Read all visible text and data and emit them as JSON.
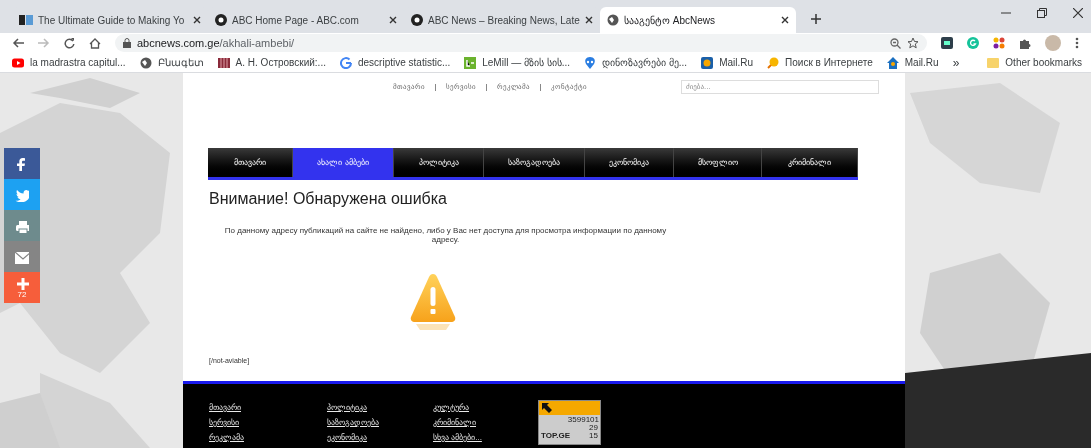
{
  "browser": {
    "tabs": [
      {
        "title": "The Ultimate Guide to Making Yo",
        "kind": "sb",
        "selected": false
      },
      {
        "title": "ABC Home Page - ABC.com",
        "kind": "abc",
        "selected": false
      },
      {
        "title": "ABC News – Breaking News, Late",
        "kind": "abc",
        "selected": false
      },
      {
        "title": "სააგენტო AbcNews",
        "kind": "globe",
        "selected": true
      }
    ],
    "url": {
      "host": "abcnews.com.ge",
      "path": "/akhali-ambebi/"
    },
    "bookmarks": [
      {
        "label": "la madrastra capitul...",
        "kind": "youtube"
      },
      {
        "label": "Բնագետ",
        "kind": "globe"
      },
      {
        "label": "А. Н. Островский:...",
        "kind": "books"
      },
      {
        "label": "descriptive statistic...",
        "kind": "google"
      },
      {
        "label": "LeMill — მზის სის...",
        "kind": "lemill"
      },
      {
        "label": "დინოზავრები მე...",
        "kind": "alien"
      },
      {
        "label": "Mail.Ru",
        "kind": "mail"
      },
      {
        "label": "Поиск в Интернете",
        "kind": "search"
      },
      {
        "label": "Mail.Ru",
        "kind": "house"
      }
    ],
    "overflow": "»",
    "other_bookmarks": "Other bookmarks"
  },
  "page": {
    "top_links": [
      "მთავარი",
      "სერვისი",
      "რეკლამა",
      "კონტაქტი"
    ],
    "search": {
      "placeholder": "ძიება..."
    },
    "nav": [
      {
        "label": "მთავარი",
        "selected": false
      },
      {
        "label": "ახალი ამბები",
        "selected": true
      },
      {
        "label": "პოლიტიკა",
        "selected": false
      },
      {
        "label": "საზოგადოება",
        "selected": false
      },
      {
        "label": "ეკონომიკა",
        "selected": false
      },
      {
        "label": "მსოფლიო",
        "selected": false
      },
      {
        "label": "კრიმინალი",
        "selected": false
      }
    ],
    "heading": "Внимание! Обнаружена ошибка",
    "message": "По данному адресу публикаций на сайте не найдено, либо у Вас нет доступа для просмотра информации по данному адресу.",
    "error_code": "[/not-aviable]",
    "share": [
      {
        "kind": "facebook",
        "color": "#3b5998"
      },
      {
        "kind": "twitter",
        "color": "#1da1f2"
      },
      {
        "kind": "print",
        "color": "#6e8b8d"
      },
      {
        "kind": "mail",
        "color": "#858585"
      },
      {
        "kind": "plus",
        "color": "#f65e3b",
        "count": "72"
      }
    ],
    "footer": {
      "columns": [
        [
          "მთავარი",
          "სერვისი",
          "რეკლამა"
        ],
        [
          "პოლიტიკა",
          "საზოგადოება",
          "ეკონომიკა"
        ],
        [
          "კულტურა",
          "კრიმინალი",
          "სხვა ამბები..."
        ]
      ]
    },
    "counter": {
      "total": "3599101",
      "today": "29",
      "online": "15",
      "brand": "TOP.GE"
    }
  }
}
